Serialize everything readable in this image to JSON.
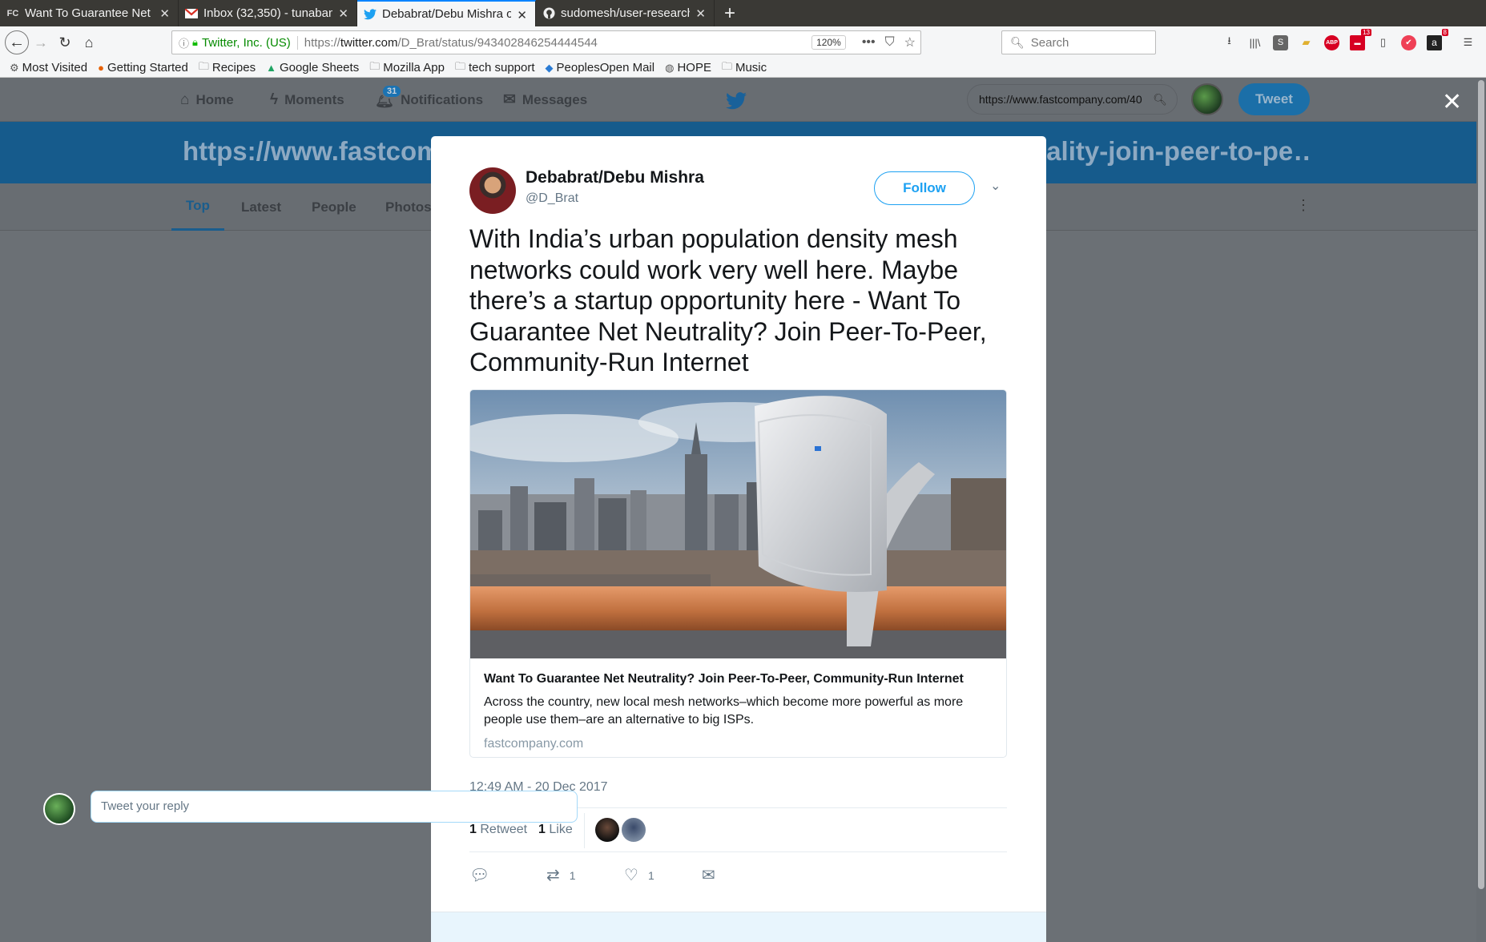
{
  "browser": {
    "tabs": [
      {
        "favicon": "FC",
        "title": "Want To Guarantee Net N",
        "active": false
      },
      {
        "favicon": "gmail-icon",
        "title": "Inbox (32,350) - tunaban",
        "active": false
      },
      {
        "favicon": "twitter-bird-icon",
        "title": "Debabrat/Debu Mishra o",
        "active": true
      },
      {
        "favicon": "github-icon",
        "title": "sudomesh/user-research",
        "active": false
      }
    ],
    "new_tab": "+",
    "identity": "Twitter, Inc. (US)",
    "url_prefix": "https://",
    "url_domain": "twitter.com",
    "url_path": "/D_Brat/status/943402846254444544",
    "zoom": "120%",
    "search_placeholder": "Search",
    "toolbar_badges": {
      "notif": "13",
      "other": "8"
    }
  },
  "bookmarks": [
    {
      "icon": "gear-icon",
      "label": "Most Visited"
    },
    {
      "icon": "firefox-icon",
      "label": "Getting Started"
    },
    {
      "icon": "folder-icon",
      "label": "Recipes"
    },
    {
      "icon": "drive-icon",
      "label": "Google Sheets"
    },
    {
      "icon": "folder-icon",
      "label": "Mozilla App"
    },
    {
      "icon": "folder-icon",
      "label": "tech support"
    },
    {
      "icon": "peoplesopen-icon",
      "label": "PeoplesOpen Mail"
    },
    {
      "icon": "globe-icon",
      "label": "HOPE"
    },
    {
      "icon": "folder-icon",
      "label": "Music"
    }
  ],
  "twitter": {
    "nav": {
      "home": "Home",
      "moments": "Moments",
      "notifications": "Notifications",
      "notif_count": "31",
      "messages": "Messages"
    },
    "search_value": "https://www.fastcompany.com/40",
    "tweet_button": "Tweet",
    "search_header": "https://www.fastcompany.com/40508888/want-to-guarantee-net-neutrality-join-peer-to-pe…",
    "tabs": [
      "Top",
      "Latest",
      "People",
      "Photos"
    ]
  },
  "tweet": {
    "author": "Debabrat/Debu Mishra",
    "handle": "@D_Brat",
    "follow_label": "Follow",
    "text": "With India’s urban population density mesh networks could work very well here. Maybe there’s a startup opportunity here - Want To Guarantee Net Neutrality? Join Peer-To-Peer, Community-Run Internet",
    "card": {
      "title": "Want To Guarantee Net Neutrality? Join Peer-To-Peer, Community-Run Internet",
      "description": "Across the country, new local mesh networks–which become more powerful as more people use them–are an alternative to big ISPs.",
      "site": "fastcompany.com"
    },
    "timestamp": "12:49 AM - 20 Dec 2017",
    "retweets_count": "1",
    "retweets_label": "Retweet",
    "likes_count": "1",
    "likes_label": "Like",
    "action_retweet_count": "1",
    "action_like_count": "1",
    "reply_placeholder": "Tweet your reply"
  },
  "colors": {
    "twitter_blue": "#1da1f2",
    "overlay": "#6b7075",
    "header_blue": "#165b8c"
  }
}
